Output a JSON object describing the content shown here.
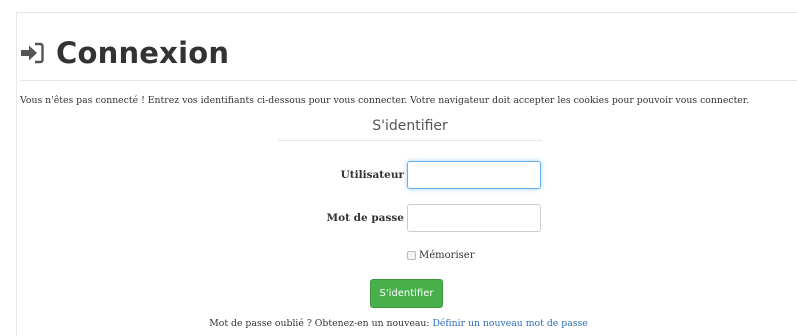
{
  "header": {
    "title": "Connexion",
    "icon": "sign-in-icon"
  },
  "intro_text": "Vous n'êtes pas connecté ! Entrez vos identifiants ci-dessous pour vous connecter. Votre navigateur doit accepter les cookies pour pouvoir vous connecter.",
  "form": {
    "section_title": "S'identifier",
    "username": {
      "label": "Utilisateur",
      "value": ""
    },
    "password": {
      "label": "Mot de passe",
      "value": ""
    },
    "remember_label": "Mémoriser",
    "remember_checked": false,
    "submit_label": "S'identifier"
  },
  "footer": {
    "forgot_text": "Mot de passe oublié ? Obtenez-en un nouveau: ",
    "forgot_link": "Définir un nouveau mot de passe"
  },
  "colors": {
    "primary_button": "#48b04b",
    "link": "#2a6ebb",
    "focus": "#66afe9"
  }
}
